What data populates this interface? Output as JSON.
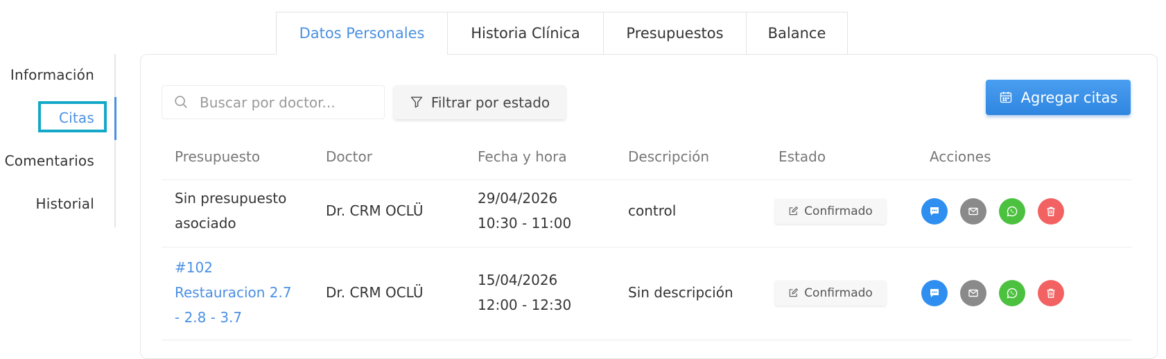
{
  "sidebar": {
    "items": [
      {
        "label": "Información"
      },
      {
        "label": "Citas"
      },
      {
        "label": "Comentarios"
      },
      {
        "label": "Historial"
      }
    ]
  },
  "tabs": [
    {
      "label": "Datos Personales"
    },
    {
      "label": "Historia Clínica"
    },
    {
      "label": "Presupuestos"
    },
    {
      "label": "Balance"
    }
  ],
  "toolbar": {
    "search_placeholder": "Buscar por doctor...",
    "filter_label": "Filtrar por estado",
    "add_label": "Agregar citas"
  },
  "table": {
    "headers": [
      "Presupuesto",
      "Doctor",
      "Fecha y hora",
      "Descripción",
      "Estado",
      "Acciones"
    ],
    "rows": [
      {
        "presupuesto": [
          "Sin presupuesto",
          "asociado"
        ],
        "doctor": "Dr. CRM OCLÜ",
        "fecha": "29/04/2026",
        "hora": "10:30 - 11:00",
        "descripcion": "control",
        "estado": "Confirmado"
      },
      {
        "presupuesto": [
          "#102",
          "Restauracion 2.7",
          "- 2.8 - 3.7"
        ],
        "doctor": "Dr. CRM OCLÜ",
        "fecha": "15/04/2026",
        "hora": "12:00 - 12:30",
        "descripcion": "Sin descripción",
        "estado": "Confirmado"
      }
    ]
  },
  "colors": {
    "accent": "#4a90e2",
    "focus_outline": "#14a8c8",
    "chat": "#2f8ff0",
    "mail": "#8a8a8a",
    "whatsapp": "#4cc13f",
    "delete": "#f26262"
  },
  "icons": [
    "search-icon",
    "filter-icon",
    "calendar-icon",
    "edit-icon",
    "chat-icon",
    "mail-icon",
    "whatsapp-icon",
    "trash-icon"
  ]
}
